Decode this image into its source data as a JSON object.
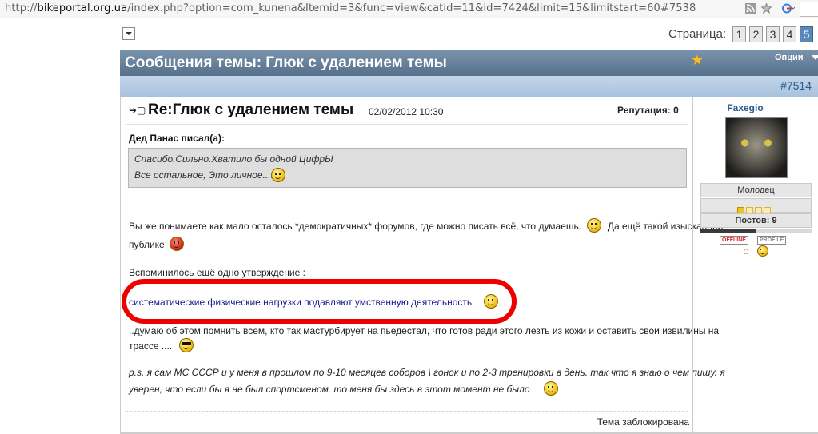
{
  "browser": {
    "url_prefix": "http://",
    "url_domain": "bikeportal.org.ua",
    "url_path": "/index.php?option=com_kunena&Itemid=3&func=view&catid=11&id=7424&limit=15&limitstart=60#7538"
  },
  "pagination": {
    "label": "Страница:",
    "pages": [
      "1",
      "2",
      "3",
      "4",
      "5"
    ],
    "current": "5"
  },
  "topic": {
    "title": "Сообщения темы: Глюк с удалением темы",
    "options_label": "Опции"
  },
  "post": {
    "anchor": "#7514",
    "subject": "Re:Глюк с удалением темы",
    "date": "02/02/2012 10:30",
    "reputation": "Репутация: 0",
    "quote_author": "Дед Панас писал(а):",
    "quote_lines": [
      "Спасибо.Сильно.Хватило бы одной ЦифрЫ",
      "Все остальное, Это личное......"
    ],
    "para1_line1": "Вы же понимаете как мало осталось *демократичных* форумов, где можно писать всё, что думаешь.",
    "para1_line1_tail": "Да ещё такой изысканной",
    "para1_line2": "публике",
    "para2": "Вспоминилось ещё одно утверждение :",
    "highlighted": "систематические физические нагрузки подавляют умственную деятельность",
    "para3_line1": "..думаю об этом помнить всем, кто так мастурбирует на пьедестал, что готов ради этого лезть из кожи и оставить свои извилины на",
    "para3_line2": "трассе ....",
    "para4_line1": "p.s. я сам МС СССР и у меня в прошлом по 9-10 месяцев соборов \\ гонок и по 2-3 тренировки в день. так что я знаю о чем пишу. я",
    "para4_line2": "уверен, что если бы я не был спортсменом. то меня бы здесь в этот момент не было",
    "locked": "Тема заблокирована"
  },
  "author": {
    "name": "Faxegio",
    "rank": "Молодец",
    "rank_stars_filled": 1,
    "rank_stars_total": 5,
    "posts": "Постов: 9",
    "status": "OFFLINE",
    "profile": "PROFILE"
  },
  "colors": {
    "header": "#566f8a",
    "subheader": "#a9c2dc",
    "highlight_oval": "#ee0000",
    "link": "#2a5c8d"
  }
}
